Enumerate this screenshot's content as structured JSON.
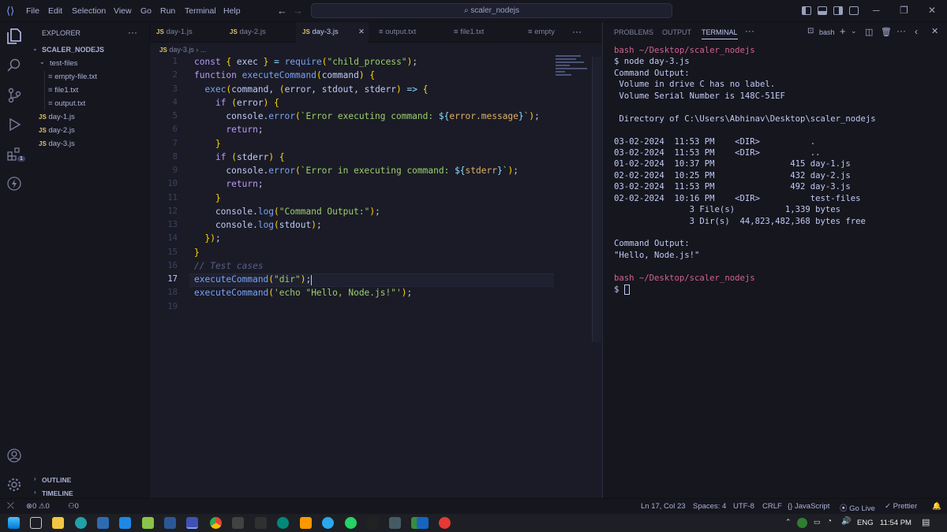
{
  "title_bar": {
    "menu": [
      "File",
      "Edit",
      "Selection",
      "View",
      "Go",
      "Run",
      "Terminal",
      "Help"
    ],
    "search": "scaler_nodejs"
  },
  "sidebar": {
    "header": "EXPLORER",
    "project": "SCALER_NODEJS",
    "folder": "test-files",
    "folder_files": [
      "empty-file.txt",
      "file1.txt",
      "output.txt"
    ],
    "js_files": [
      "day-1.js",
      "day-2.js",
      "day-3.js"
    ],
    "outline": "OUTLINE",
    "timeline": "TIMELINE",
    "ext_badge": "1"
  },
  "editor": {
    "tabs": [
      {
        "label": "day-1.js",
        "type": "js"
      },
      {
        "label": "day-2.js",
        "type": "js"
      },
      {
        "label": "day-3.js",
        "type": "js"
      },
      {
        "label": "output.txt",
        "type": "txt"
      },
      {
        "label": "file1.txt",
        "type": "txt"
      },
      {
        "label": "empty",
        "type": "txt"
      }
    ],
    "breadcrumb_file": "day-3.js",
    "breadcrumb_more": "...",
    "js_tag": "JS",
    "current_line": 17
  },
  "code_lines": [
    "const { exec } = require(\"child_process\");",
    "function executeCommand(command) {",
    "  exec(command, (error, stdout, stderr) => {",
    "    if (error) {",
    "      console.error(`Error executing command: ${error.message}`);",
    "      return;",
    "    }",
    "    if (stderr) {",
    "      console.error(`Error in executing command: ${stderr}`);",
    "      return;",
    "    }",
    "    console.log(\"Command Output:\");",
    "    console.log(stdout);",
    "  });",
    "}",
    "// Test cases",
    "executeCommand(\"dir\");",
    "executeCommand('echo \"Hello, Node.js!\"');",
    ""
  ],
  "panel": {
    "tabs": [
      "PROBLEMS",
      "OUTPUT",
      "TERMINAL"
    ],
    "shell": "bash"
  },
  "terminal_lines": [
    {
      "text": "bash ~/Desktop/scaler_nodejs",
      "style": "prompt"
    },
    {
      "text": "$ node day-3.js",
      "style": "plain"
    },
    {
      "text": "Command Output:",
      "style": "plain"
    },
    {
      "text": " Volume in drive C has no label.",
      "style": "plain"
    },
    {
      "text": " Volume Serial Number is 148C-51EF",
      "style": "plain"
    },
    {
      "text": "",
      "style": "plain"
    },
    {
      "text": " Directory of C:\\Users\\Abhinav\\Desktop\\scaler_nodejs",
      "style": "plain"
    },
    {
      "text": "",
      "style": "plain"
    },
    {
      "text": "03-02-2024  11:53 PM    <DIR>          .",
      "style": "plain"
    },
    {
      "text": "03-02-2024  11:53 PM    <DIR>          ..",
      "style": "plain"
    },
    {
      "text": "01-02-2024  10:37 PM               415 day-1.js",
      "style": "plain"
    },
    {
      "text": "02-02-2024  10:25 PM               432 day-2.js",
      "style": "plain"
    },
    {
      "text": "03-02-2024  11:53 PM               492 day-3.js",
      "style": "plain"
    },
    {
      "text": "02-02-2024  10:16 PM    <DIR>          test-files",
      "style": "plain"
    },
    {
      "text": "               3 File(s)          1,339 bytes",
      "style": "plain"
    },
    {
      "text": "               3 Dir(s)  44,823,482,368 bytes free",
      "style": "plain"
    },
    {
      "text": "",
      "style": "plain"
    },
    {
      "text": "Command Output:",
      "style": "plain"
    },
    {
      "text": "\"Hello, Node.js!\"",
      "style": "plain"
    },
    {
      "text": "",
      "style": "plain"
    },
    {
      "text": "bash ~/Desktop/scaler_nodejs",
      "style": "prompt"
    },
    {
      "text": "$ ",
      "style": "cursor"
    }
  ],
  "status": {
    "errors": "0",
    "warnings": "0",
    "ports": "0",
    "position": "Ln 17, Col 23",
    "spaces": "Spaces: 4",
    "encoding": "UTF-8",
    "eol": "CRLF",
    "language": "JavaScript",
    "go_live": "Go Live",
    "prettier": "Prettier"
  },
  "taskbar": {
    "language": "ENG",
    "time": "11:54 PM"
  }
}
